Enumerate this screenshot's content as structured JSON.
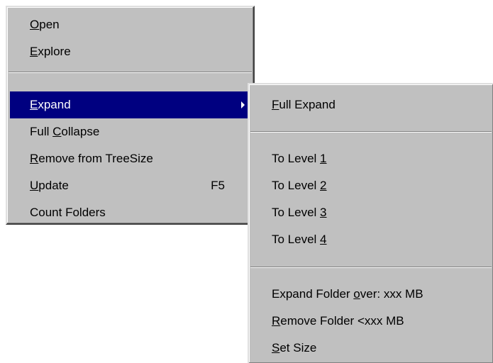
{
  "main_menu": {
    "items": [
      {
        "pre": "",
        "key": "O",
        "post": "pen",
        "shortcut": ""
      },
      {
        "pre": "",
        "key": "E",
        "post": "xplore",
        "shortcut": ""
      },
      {
        "pre": "",
        "key": "E",
        "post": "xpand",
        "shortcut": "",
        "highlighted": true,
        "has_submenu": true
      },
      {
        "pre": "Full ",
        "key": "C",
        "post": "ollapse",
        "shortcut": ""
      },
      {
        "pre": "",
        "key": "R",
        "post": "emove from TreeSize",
        "shortcut": ""
      },
      {
        "pre": "",
        "key": "U",
        "post": "pdate",
        "shortcut": "F5"
      },
      {
        "pre": "Count Folders",
        "key": "",
        "post": "",
        "shortcut": ""
      }
    ]
  },
  "sub_menu": {
    "items": [
      {
        "pre": "",
        "key": "F",
        "post": "ull Expand"
      },
      {
        "pre": "To Level ",
        "key": "1",
        "post": ""
      },
      {
        "pre": "To Level ",
        "key": "2",
        "post": ""
      },
      {
        "pre": "To Level ",
        "key": "3",
        "post": ""
      },
      {
        "pre": "To Level ",
        "key": "4",
        "post": ""
      },
      {
        "pre": "Expand Folder ",
        "key": "o",
        "post": "ver: xxx MB"
      },
      {
        "pre": "",
        "key": "R",
        "post": "emove Folder <xxx MB"
      },
      {
        "pre": "",
        "key": "S",
        "post": "et Size"
      }
    ]
  },
  "colors": {
    "menu_bg": "#c0c0c0",
    "highlight_bg": "#000080",
    "highlight_text": "#ffffff"
  }
}
